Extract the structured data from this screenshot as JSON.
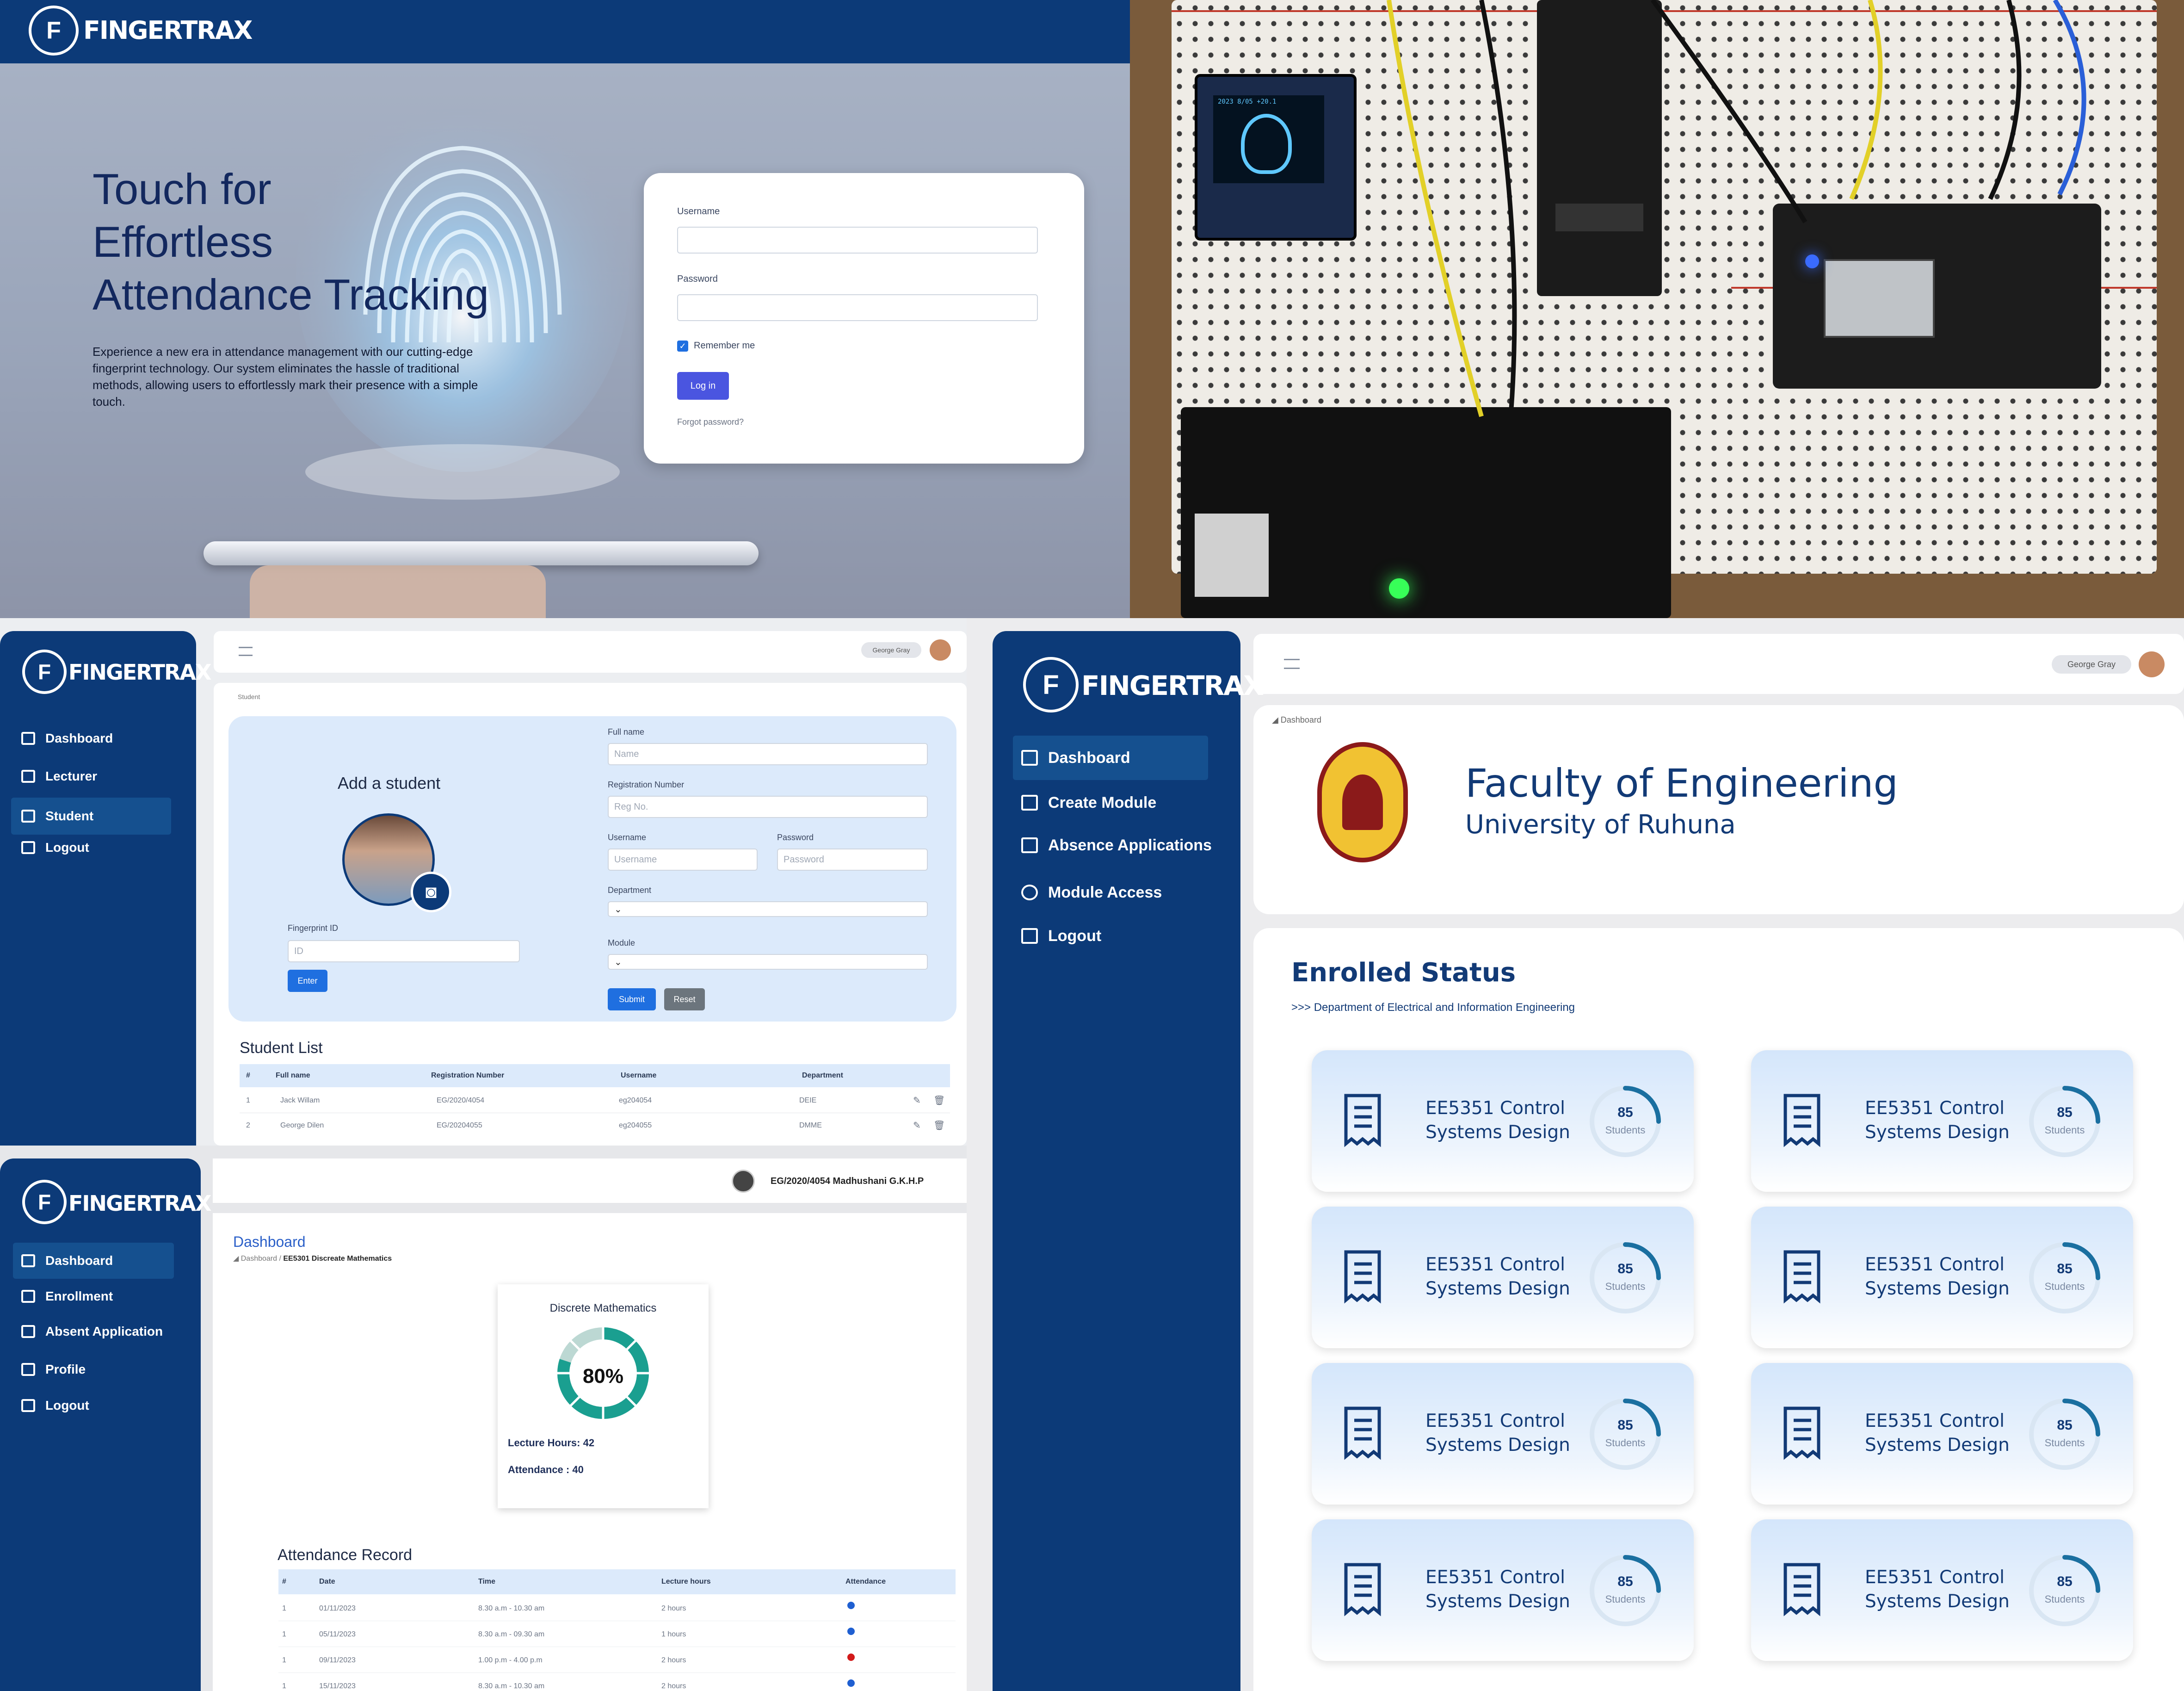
{
  "brand": {
    "name": "FINGERTRAX"
  },
  "colors": {
    "navy": "#0c3a78",
    "accent": "#4a55e0",
    "attendance_present": "#1f5fd1",
    "attendance_absent": "#d21a1a",
    "gauge": "#1a9f90"
  },
  "login_page": {
    "headline": [
      "Touch for",
      "Effortless",
      "Attendance Tracking"
    ],
    "description": "Experience a new era in attendance management with our cutting-edge fingerprint technology. Our system eliminates the hassle of traditional methods, allowing users to effortlessly mark their presence with a simple touch.",
    "form": {
      "username_label": "Username",
      "password_label": "Password",
      "remember_label": "Remember me",
      "remember_checked": true,
      "login_button": "Log in",
      "forgot_link": "Forgot password?"
    }
  },
  "hardware_photo": {
    "oled_labels": "2023 8/05 +20.1"
  },
  "add_student_page": {
    "sidebar": [
      "Dashboard",
      "Lecturer",
      "Student",
      "Logout"
    ],
    "active_item": "Student",
    "user_chip": "George Gray",
    "breadcrumb": "Student",
    "form": {
      "title": "Add a student",
      "full_name_label": "Full name",
      "full_name_placeholder": "Name",
      "reg_label": "Registration Number",
      "reg_placeholder": "Reg No.",
      "username_label": "Username",
      "username_placeholder": "Username",
      "password_label": "Password",
      "password_placeholder": "Password",
      "department_label": "Department",
      "module_label": "Module",
      "fingerprint_label": "Fingerprint ID",
      "fingerprint_placeholder": "ID",
      "enter_button": "Enter",
      "submit_button": "Submit",
      "reset_button": "Reset"
    },
    "student_list": {
      "title": "Student List",
      "columns": [
        "#",
        "Full name",
        "Registration Number",
        "Username",
        "Department"
      ],
      "rows": [
        [
          "1",
          "Jack Willam",
          "EG/2020/4054",
          "eg204054",
          "DEIE"
        ],
        [
          "2",
          "George Dilen",
          "EG/20204055",
          "eg204055",
          "DMME"
        ]
      ]
    }
  },
  "lecturer_dashboard": {
    "sidebar": [
      "Dashboard",
      "Create Module",
      "Absence Applications",
      "Module Access",
      "Logout"
    ],
    "active_item": "Dashboard",
    "user_chip": "George Gray",
    "breadcrumb": "Dashboard",
    "faculty_title": "Faculty of Engineering",
    "university": "University of Ruhuna",
    "enrolled_title": "Enrolled Status",
    "department_line": ">>> Department of Electrical and Information Engineering",
    "cards": [
      {
        "title": "EE5351 Control Systems Design",
        "count": "85",
        "unit": "Students"
      },
      {
        "title": "EE5351 Control Systems Design",
        "count": "85",
        "unit": "Students"
      },
      {
        "title": "EE5351 Control Systems Design",
        "count": "85",
        "unit": "Students"
      },
      {
        "title": "EE5351 Control Systems Design",
        "count": "85",
        "unit": "Students"
      },
      {
        "title": "EE5351 Control Systems Design",
        "count": "85",
        "unit": "Students"
      },
      {
        "title": "EE5351 Control Systems Design",
        "count": "85",
        "unit": "Students"
      },
      {
        "title": "EE5351 Control Systems Design",
        "count": "85",
        "unit": "Students"
      },
      {
        "title": "EE5351 Control Systems Design",
        "count": "85",
        "unit": "Students"
      }
    ]
  },
  "student_dashboard": {
    "sidebar": [
      "Dashboard",
      "Enrollment",
      "Absent Application",
      "Profile",
      "Logout"
    ],
    "active_item": "Dashboard",
    "user_label": "EG/2020/4054 Madhushani G.K.H.P",
    "page_title": "Dashboard",
    "breadcrumb_root": "Dashboard /",
    "breadcrumb_current": "EE5301 Discreate Mathematics",
    "module_card": {
      "title": "Discrete Mathematics",
      "percent_label": "80%",
      "percent": 80,
      "lecture_hours": "Lecture Hours: 42",
      "attendance": "Attendance : 40"
    },
    "record": {
      "title": "Attendance Record",
      "columns": [
        "#",
        "Date",
        "Time",
        "Lecture hours",
        "Attendance"
      ],
      "rows": [
        {
          "n": "1",
          "date": "01/11/2023",
          "time": "8.30 a.m - 10.30 am",
          "hours": "2 hours",
          "status": "present"
        },
        {
          "n": "1",
          "date": "05/11/2023",
          "time": "8.30 a.m - 09.30 am",
          "hours": "1 hours",
          "status": "present"
        },
        {
          "n": "1",
          "date": "09/11/2023",
          "time": "1.00 p.m - 4.00 p.m",
          "hours": "2 hours",
          "status": "absent"
        },
        {
          "n": "1",
          "date": "15/11/2023",
          "time": "8.30 a.m - 10.30 am",
          "hours": "2 hours",
          "status": "present"
        }
      ]
    }
  }
}
